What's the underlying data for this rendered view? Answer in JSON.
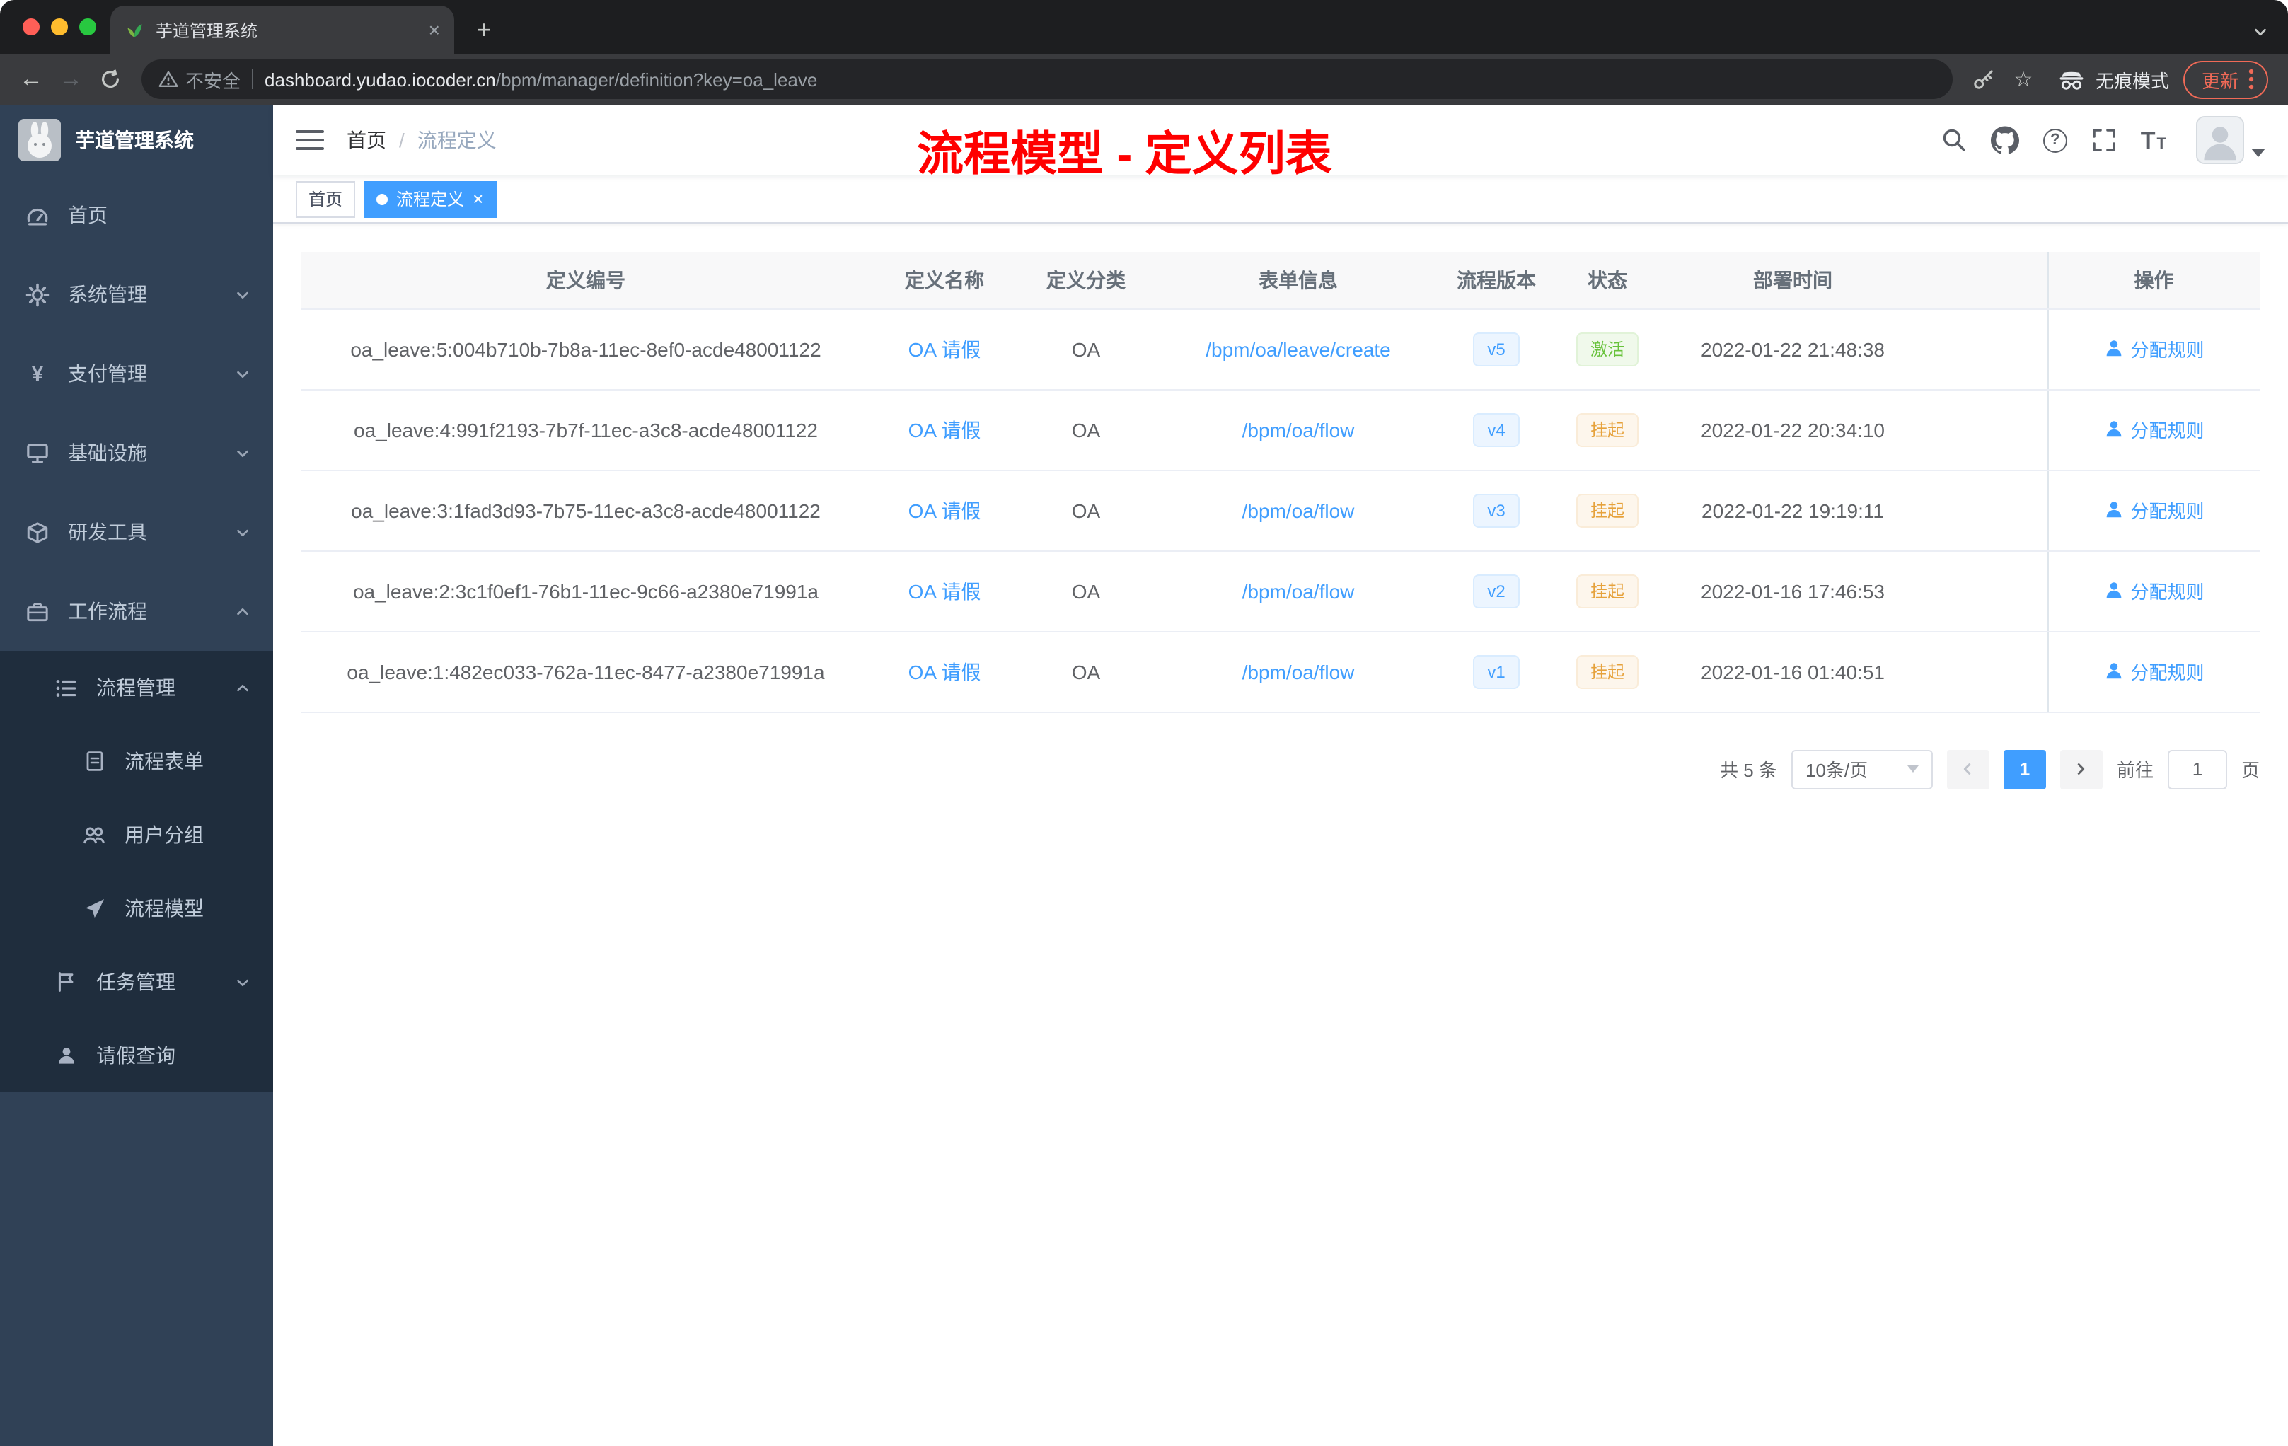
{
  "colors": {
    "accent": "#409eff",
    "success": "#67c23a",
    "warning": "#e6a23c",
    "annotation_red": "#ff0000",
    "sidebar_bg": "#304156",
    "submenu_bg": "#1f2d3d"
  },
  "icons": {
    "back": "←",
    "forward": "→",
    "star": "☆",
    "yen": "¥",
    "question": "?",
    "plus": "+",
    "close": "×",
    "font_big": "T",
    "font_small": "T"
  },
  "browser": {
    "tab_title": "芋道管理系统",
    "security_label": "不安全",
    "url_domain": "dashboard.yudao.iocoder.cn",
    "url_path": "/bpm/manager/definition?key=oa_leave",
    "incognito_label": "无痕模式",
    "update_label": "更新"
  },
  "sidebar": {
    "logo_title": "芋道管理系统",
    "items": [
      {
        "label": "首页"
      },
      {
        "label": "系统管理"
      },
      {
        "label": "支付管理"
      },
      {
        "label": "基础设施"
      },
      {
        "label": "研发工具"
      },
      {
        "label": "工作流程"
      },
      {
        "label": "流程管理"
      },
      {
        "label": "流程表单"
      },
      {
        "label": "用户分组"
      },
      {
        "label": "流程模型"
      },
      {
        "label": "任务管理"
      },
      {
        "label": "请假查询"
      }
    ]
  },
  "navbar": {
    "breadcrumb": {
      "home": "首页",
      "separator": "/",
      "current": "流程定义"
    }
  },
  "annotation": {
    "text": "流程模型 - 定义列表"
  },
  "tags": {
    "items": [
      {
        "label": "首页"
      },
      {
        "label": "流程定义"
      }
    ]
  },
  "table": {
    "columns": [
      "定义编号",
      "定义名称",
      "定义分类",
      "表单信息",
      "流程版本",
      "状态",
      "部署时间",
      "操作"
    ],
    "rows": [
      {
        "id": "oa_leave:5:004b710b-7b8a-11ec-8ef0-acde48001122",
        "name": "OA 请假",
        "category": "OA",
        "form": "/bpm/oa/leave/create",
        "version": "v5",
        "status": "激活",
        "deployed_at": "2022-01-22 21:48:38",
        "action_label": "分配规则"
      },
      {
        "id": "oa_leave:4:991f2193-7b7f-11ec-a3c8-acde48001122",
        "name": "OA 请假",
        "category": "OA",
        "form": "/bpm/oa/flow",
        "version": "v4",
        "status": "挂起",
        "deployed_at": "2022-01-22 20:34:10",
        "action_label": "分配规则"
      },
      {
        "id": "oa_leave:3:1fad3d93-7b75-11ec-a3c8-acde48001122",
        "name": "OA 请假",
        "category": "OA",
        "form": "/bpm/oa/flow",
        "version": "v3",
        "status": "挂起",
        "deployed_at": "2022-01-22 19:19:11",
        "action_label": "分配规则"
      },
      {
        "id": "oa_leave:2:3c1f0ef1-76b1-11ec-9c66-a2380e71991a",
        "name": "OA 请假",
        "category": "OA",
        "form": "/bpm/oa/flow",
        "version": "v2",
        "status": "挂起",
        "deployed_at": "2022-01-16 17:46:53",
        "action_label": "分配规则"
      },
      {
        "id": "oa_leave:1:482ec033-762a-11ec-8477-a2380e71991a",
        "name": "OA 请假",
        "category": "OA",
        "form": "/bpm/oa/flow",
        "version": "v1",
        "status": "挂起",
        "deployed_at": "2022-01-16 01:40:51",
        "action_label": "分配规则"
      }
    ]
  },
  "pagination": {
    "total_label": "共 5 条",
    "page_size_label": "10条/页",
    "current_page": "1",
    "goto_label": "前往",
    "goto_value": "1",
    "page_unit": "页"
  }
}
